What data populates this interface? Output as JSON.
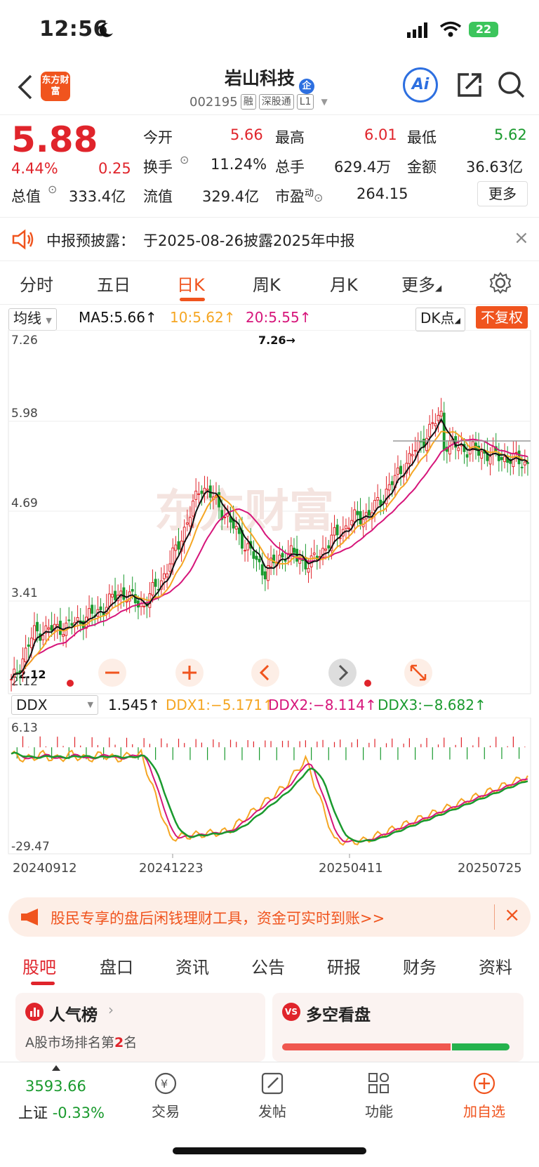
{
  "status": {
    "time": "12:56",
    "battery": "22"
  },
  "nav": {
    "logo": "东方财富",
    "title": "岩山科技",
    "code": "002195",
    "tags": [
      "融",
      "深股通",
      "L1"
    ],
    "ai_label": "Ai"
  },
  "quote": {
    "price": "5.88",
    "change_pct": "4.44%",
    "change": "0.25",
    "open_label": "今开",
    "open": "5.66",
    "high_label": "最高",
    "high": "6.01",
    "low_label": "最低",
    "low": "5.62",
    "turnover_label": "换手",
    "turnover": "11.24%",
    "volume_label": "总手",
    "volume": "629.4万",
    "amount_label": "金额",
    "amount": "36.63亿",
    "mcap_label": "总值",
    "mcap": "333.4亿",
    "float_label": "流值",
    "float": "329.4亿",
    "pe_label": "市盈",
    "pe_sup": "动",
    "pe": "264.15",
    "more": "更多"
  },
  "notice": {
    "label": "中报预披露：",
    "text": "于2025-08-26披露2025年中报"
  },
  "ktabs": [
    "分时",
    "五日",
    "日K",
    "周K",
    "月K",
    "更多"
  ],
  "chart": {
    "ma_select": "均线",
    "ma5": "MA5:5.66↑",
    "ma10": "10:5.62↑",
    "ma20": "20:5.55↑",
    "dk": "DK点",
    "adjust": "不复权",
    "price_ticks": [
      "7.26",
      "5.98",
      "4.69",
      "3.41",
      "2.12"
    ],
    "peak_label": "7.26→",
    "low_label": "2.12",
    "ind_select": "DDX",
    "ddx": "1.545↑",
    "ddx1": "DDX1:−5.171↑",
    "ddx2": "DDX2:−8.114↑",
    "ddx3": "DDX3:−8.682↑",
    "ind_ticks": [
      "6.13",
      "-29.47"
    ],
    "dates": [
      "20240912",
      "20241223",
      "20250411",
      "20250725"
    ],
    "colors": {
      "ma5": "#111111",
      "ma10": "#f5a623",
      "ma20": "#d6157a",
      "ddx3": "#1a9a2e"
    }
  },
  "ad": {
    "text": "股民专享的盘后闲钱理财工具，资金可实时到账>>"
  },
  "btabs": [
    "股吧",
    "盘口",
    "资讯",
    "公告",
    "研报",
    "财务",
    "资料"
  ],
  "cards": {
    "left_title": "人气榜",
    "left_sub_prefix": "A股市场排名第",
    "left_rank": "2",
    "left_sub_suffix": "名",
    "right_title": "多空看盘",
    "right_badge": "VS"
  },
  "bottom": {
    "index_value": "3593.66",
    "index_name": "上证",
    "index_change": "-0.33%",
    "items": [
      "交易",
      "发帖",
      "功能",
      "加自选"
    ]
  }
}
